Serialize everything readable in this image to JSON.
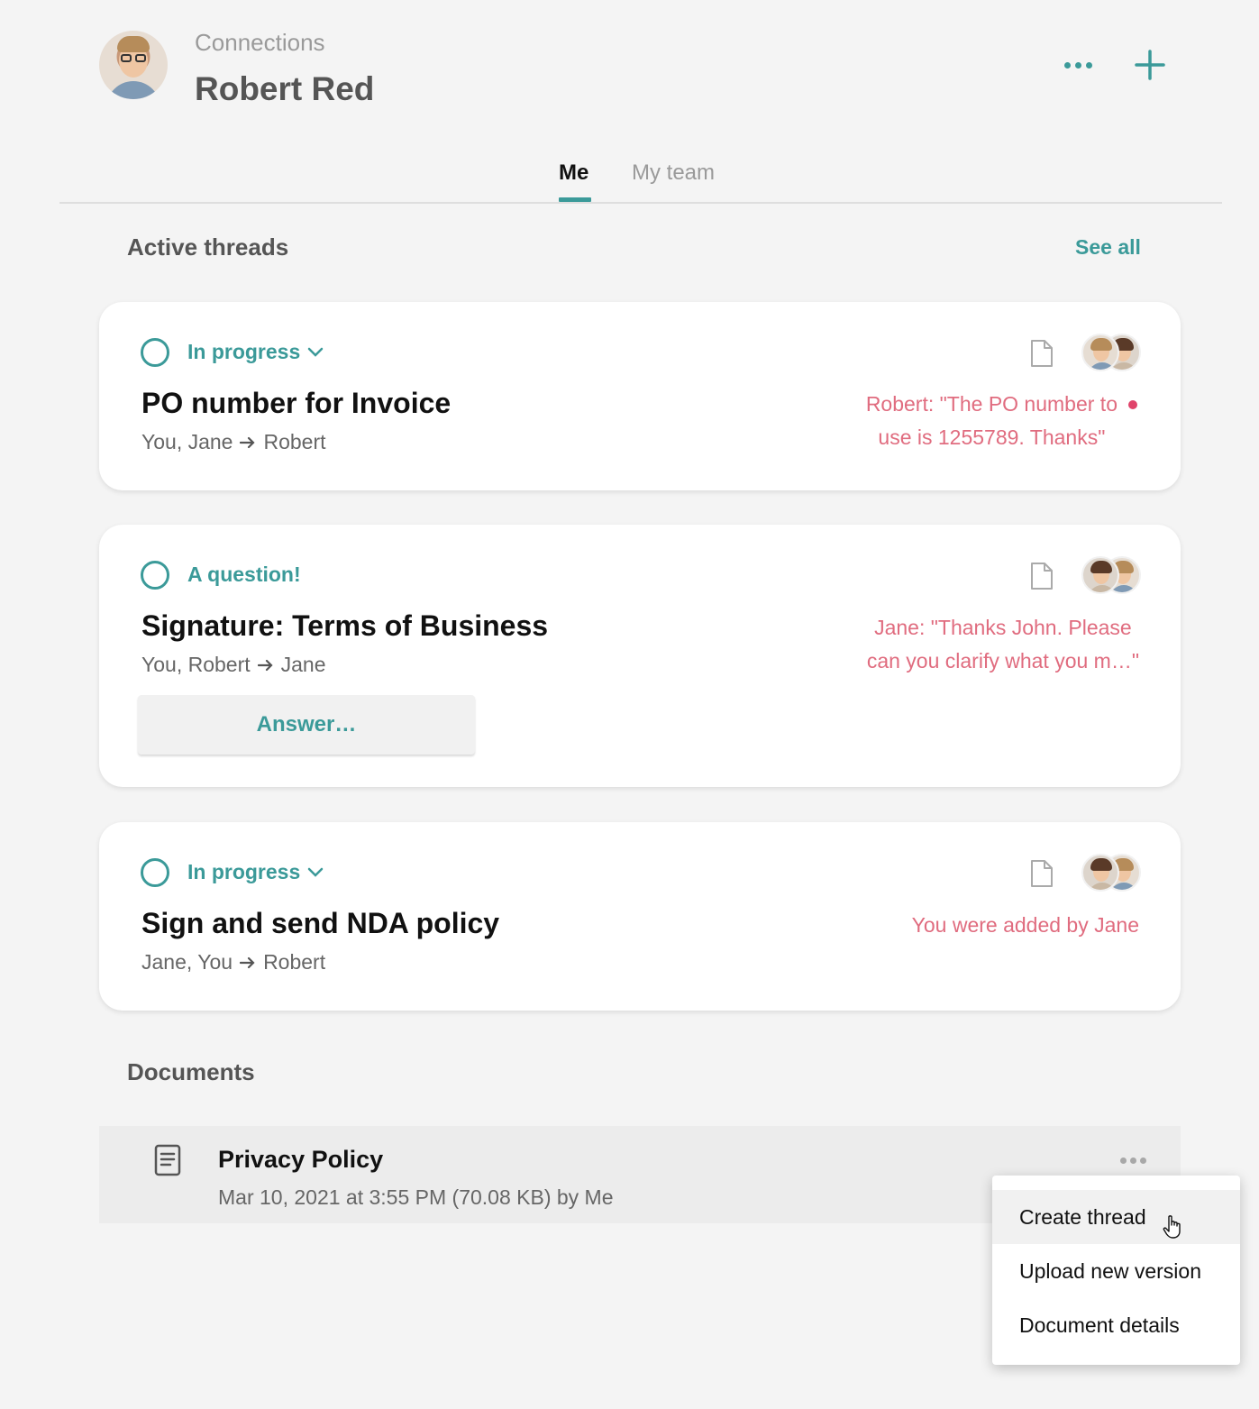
{
  "header": {
    "breadcrumb": "Connections",
    "title": "Robert Red",
    "more_icon": "more-horizontal-icon",
    "add_icon": "plus-icon"
  },
  "tabs": [
    {
      "label": "Me",
      "active": true
    },
    {
      "label": "My team",
      "active": false
    }
  ],
  "active_threads": {
    "heading": "Active threads",
    "see_all": "See all",
    "threads": [
      {
        "status": "In progress",
        "has_dropdown": true,
        "title": "PO number for Invoice",
        "from": "You, Jane",
        "to": "Robert",
        "message_line1": "Robert: \"The PO number to",
        "message_line2": "use is 1255789. Thanks\"",
        "unread": true
      },
      {
        "status": "A question!",
        "has_dropdown": false,
        "title": "Signature: Terms of Business",
        "from": "You, Robert",
        "to": "Jane",
        "message_line1": "Jane: \"Thanks John. Please",
        "message_line2": "can you clarify what you m…\"",
        "unread": false,
        "action": "Answer…"
      },
      {
        "status": "In progress",
        "has_dropdown": true,
        "title": "Sign and send NDA policy",
        "from": "Jane, You",
        "to": "Robert",
        "message_line1": "You were added by Jane",
        "unread": false
      }
    ]
  },
  "documents": {
    "heading": "Documents",
    "items": [
      {
        "name": "Privacy Policy",
        "meta": "Mar 10, 2021 at 3:55 PM (70.08 KB) by Me"
      }
    ]
  },
  "context_menu": {
    "items": [
      "Create thread",
      "Upload new version",
      "Document details"
    ],
    "hovered_index": 0
  },
  "colors": {
    "accent": "#3b9a99",
    "message": "#e06c7f",
    "unread_dot": "#e0436a",
    "background": "#f4f4f4"
  }
}
